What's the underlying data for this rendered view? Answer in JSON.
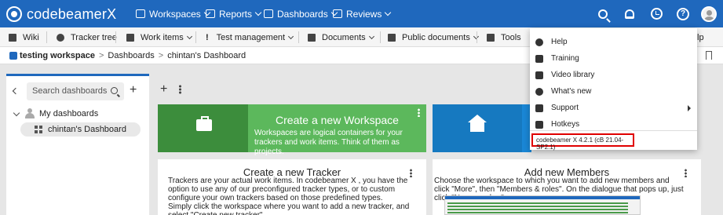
{
  "app": {
    "logo_text": "codebeamerX"
  },
  "topnav": {
    "workspaces": "Workspaces",
    "reports": "Reports",
    "dashboards": "Dashboards",
    "reviews": "Reviews"
  },
  "subnav": {
    "wiki": "Wiki",
    "tracker_tree": "Tracker tree",
    "work_items": "Work items",
    "test_management": "Test management",
    "documents": "Documents",
    "public_documents": "Public documents",
    "tools": "Tools",
    "help_partial": "Help"
  },
  "breadcrumb": {
    "workspace": "testing workspace",
    "separator": ">",
    "section": "Dashboards",
    "page": "chintan's Dashboard"
  },
  "sidebar": {
    "search_placeholder": "Search dashboards",
    "group": "My dashboards",
    "items": [
      {
        "label": "chintan's Dashboard"
      }
    ]
  },
  "cards": {
    "workspace": {
      "title": "Create a new Workspace",
      "desc": "Workspaces are logical containers for your trackers and work items. Think of them as projects."
    },
    "tracker": {
      "title": "Create a new Tracker",
      "line1": "Trackers are your actual work items. In codebeamer X , you have the option to use any of our preconfigured tracker types, or to custom configure your own trackers based on those predefined types.",
      "line2": "Simply click the workspace where you want to add a new tracker, and select \"Create new tracker\"."
    },
    "members": {
      "title": "Add new Members",
      "text": "Choose the workspace to which you want to add new members and click \"More\", then \"Members & roles\". On the dialogue that pops up, just click \"New member\"."
    }
  },
  "help_menu": {
    "items": [
      {
        "label": "Help",
        "icon": "help-circle-icon"
      },
      {
        "label": "Training",
        "icon": "graduation-cap-icon"
      },
      {
        "label": "Video library",
        "icon": "video-icon"
      },
      {
        "label": "What's new",
        "icon": "flame-icon"
      },
      {
        "label": "Support",
        "icon": "question-square-icon"
      },
      {
        "label": "Hotkeys",
        "icon": "keyboard-icon"
      }
    ],
    "version": "codebeamer X 4.2.1 (cB 21.04-SP2.1)"
  },
  "colors": {
    "brand_blue": "#1f68bd",
    "card_green": "#5cb85c",
    "card_blue": "#1a87d6",
    "highlight_red": "#e00000"
  }
}
